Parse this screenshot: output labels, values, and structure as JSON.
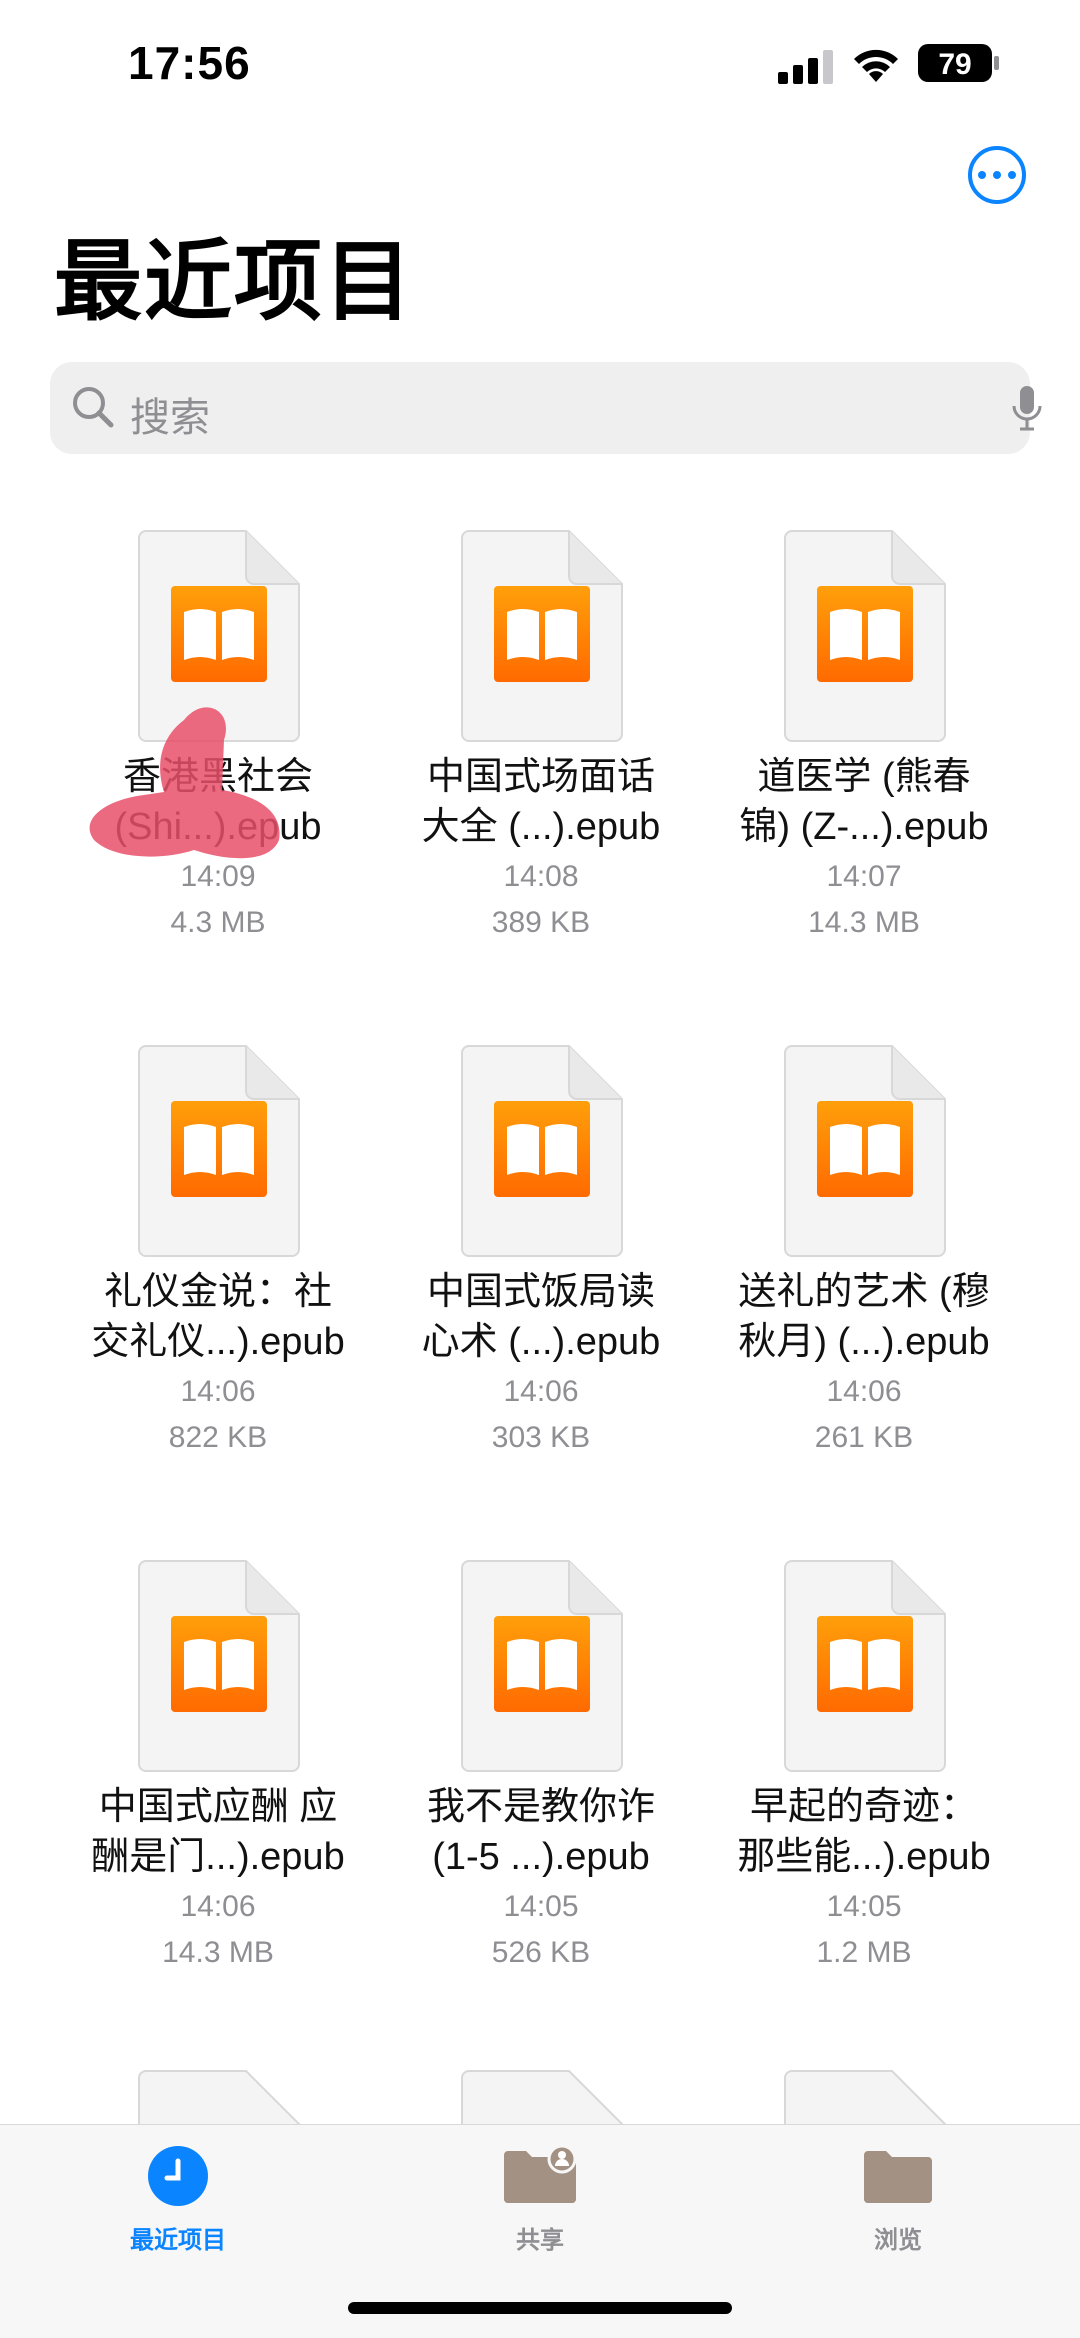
{
  "status_bar": {
    "time": "17:56",
    "battery": "79"
  },
  "header": {
    "title": "最近项目"
  },
  "search": {
    "placeholder": "搜索"
  },
  "files": [
    {
      "name_line1": "香港黑社会",
      "name_line2": "(Shi...).epub",
      "time": "14:09",
      "size": "4.3 MB"
    },
    {
      "name_line1": "中国式场面话",
      "name_line2": "大全 (...).epub",
      "time": "14:08",
      "size": "389 KB"
    },
    {
      "name_line1": "道医学 (熊春",
      "name_line2": "锦) (Z-...).epub",
      "time": "14:07",
      "size": "14.3 MB"
    },
    {
      "name_line1": "礼仪金说：社",
      "name_line2": "交礼仪...).epub",
      "time": "14:06",
      "size": "822 KB"
    },
    {
      "name_line1": "中国式饭局读",
      "name_line2": "心术 (...).epub",
      "time": "14:06",
      "size": "303 KB"
    },
    {
      "name_line1": "送礼的艺术 (穆",
      "name_line2": "秋月) (...).epub",
      "time": "14:06",
      "size": "261 KB"
    },
    {
      "name_line1": "中国式应酬 应",
      "name_line2": "酬是门...).epub",
      "time": "14:06",
      "size": "14.3 MB"
    },
    {
      "name_line1": "我不是教你诈",
      "name_line2": "(1-5 ...).epub",
      "time": "14:05",
      "size": "526 KB"
    },
    {
      "name_line1": "早起的奇迹：",
      "name_line2": "那些能...).epub",
      "time": "14:05",
      "size": "1.2 MB"
    }
  ],
  "tabs": [
    {
      "label": "最近项目",
      "icon": "clock-icon",
      "active": true
    },
    {
      "label": "共享",
      "icon": "shared-folder-icon",
      "active": false
    },
    {
      "label": "浏览",
      "icon": "folder-icon",
      "active": false
    }
  ],
  "colors": {
    "accent": "#0a84ff",
    "books_orange": "#ff8a00",
    "secondary_text": "#8e8e93"
  }
}
